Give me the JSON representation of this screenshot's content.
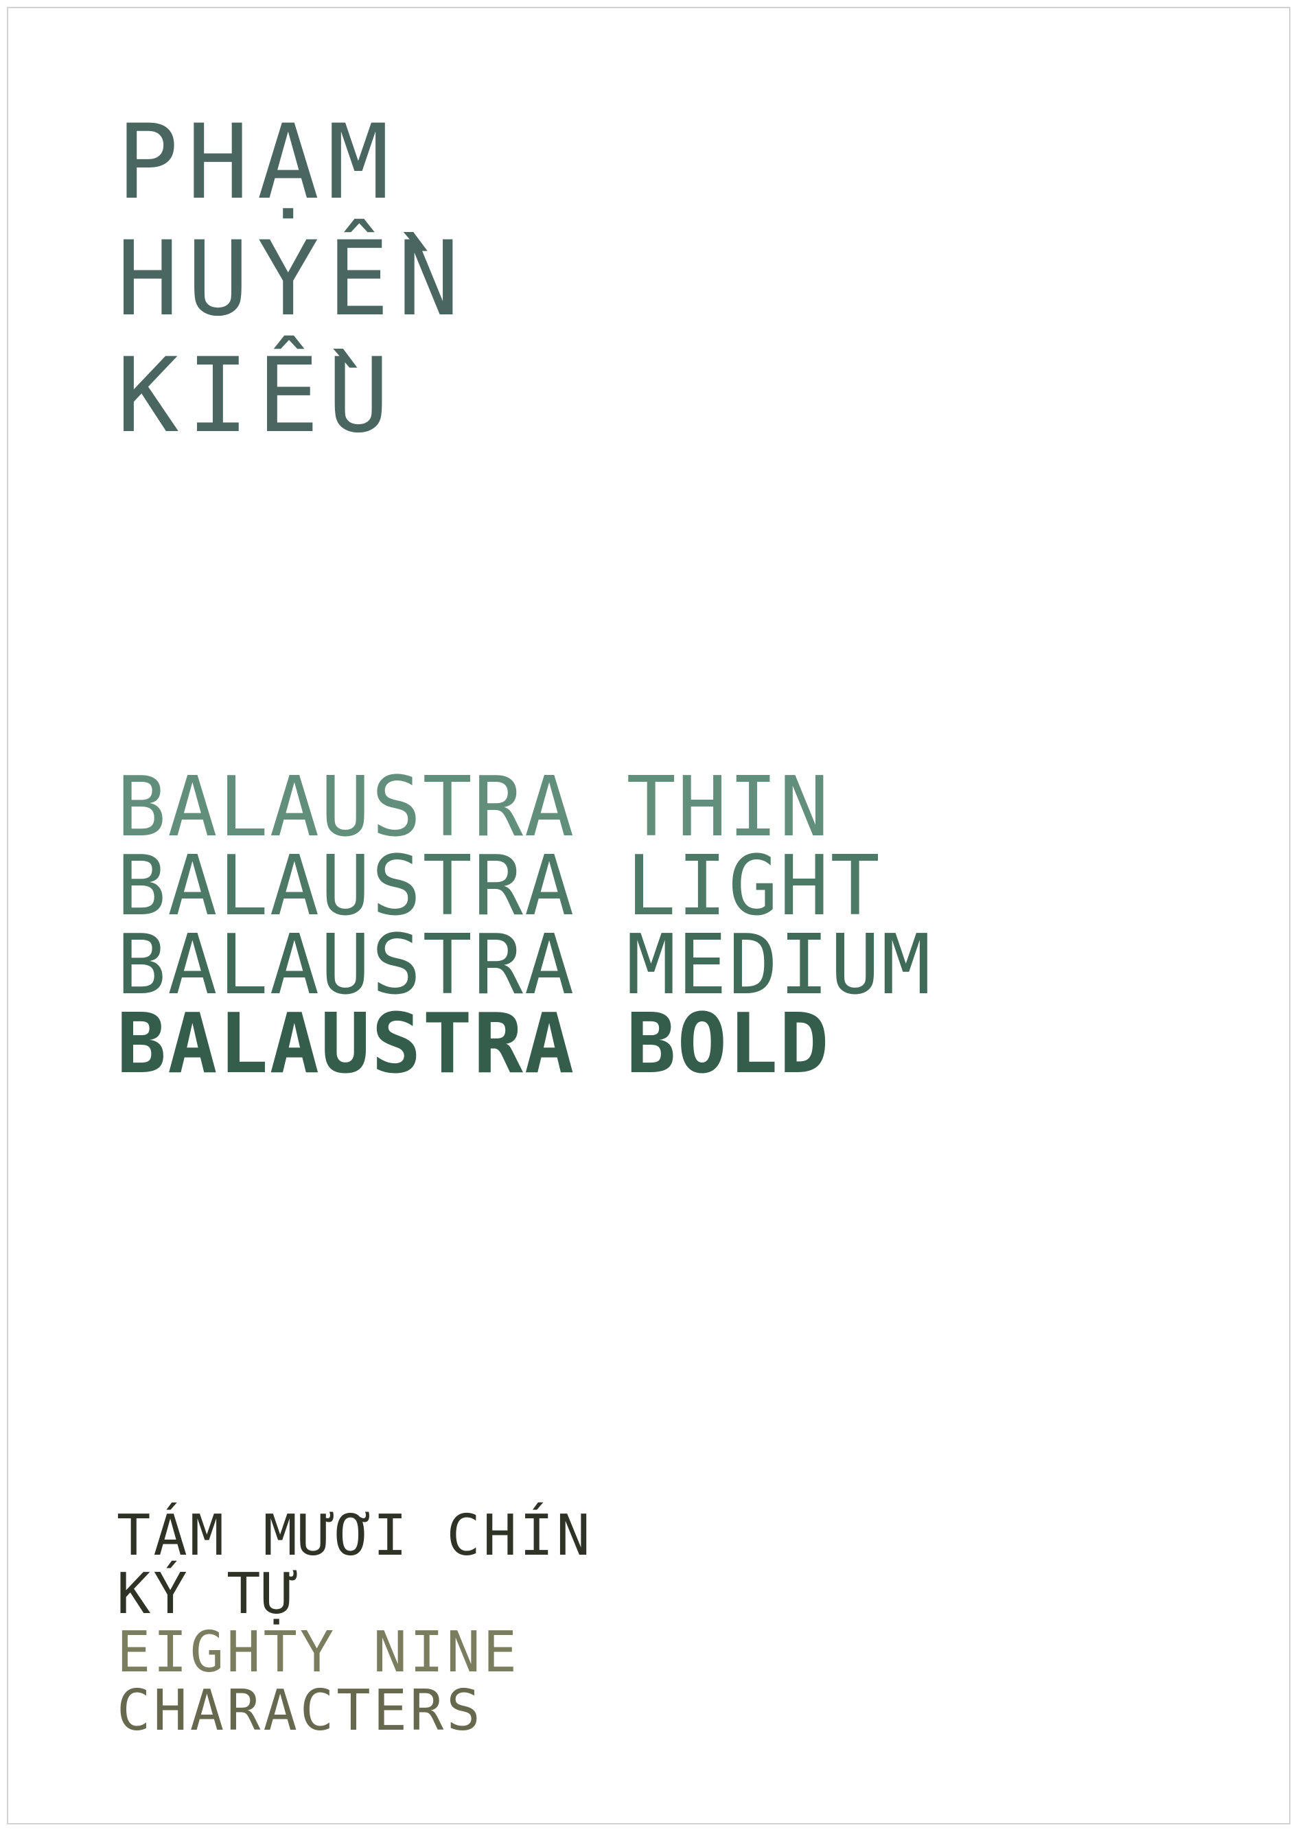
{
  "author": {
    "line1": "PHẠM",
    "line2": "HUYỀN",
    "line3": "KIỀU"
  },
  "weights": {
    "thin": "BALAUSTRA THIN",
    "light": "BALAUSTRA LIGHT",
    "medium": "BALAUSTRA MEDIUM",
    "bold": "BALAUSTRA BOLD"
  },
  "characters": {
    "vi_line1": "TÁM MƯƠI CHÍN",
    "vi_line2": "KÝ TỰ",
    "en_line1": "EIGHTY NINE",
    "en_line2": "CHARACTERS"
  },
  "colors": {
    "name": "#4a6660",
    "thin": "#5a8a74",
    "light": "#4c7a66",
    "medium": "#3f6b58",
    "bold": "#345d4c",
    "vietnamese_text": "#2f3326",
    "english_text": "#7b7d5f"
  }
}
